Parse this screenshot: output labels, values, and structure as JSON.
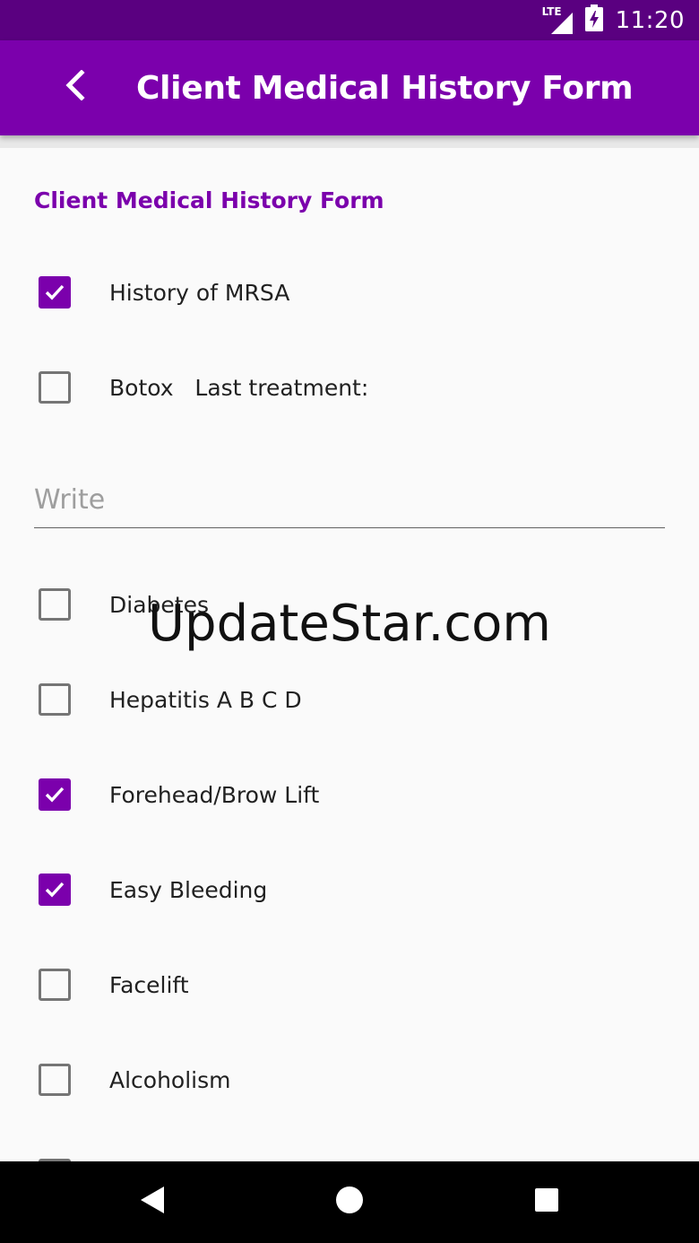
{
  "status_bar": {
    "network": "LTE",
    "time": "11:20",
    "icons": [
      "lte-signal-icon",
      "battery-charging-icon"
    ]
  },
  "app_bar": {
    "title": "Client Medical History Form",
    "back_icon": "chevron-left-icon"
  },
  "form": {
    "section_title": "Client Medical History Form",
    "items": [
      {
        "label": "History of MRSA",
        "checked": true
      },
      {
        "label": "Botox   Last treatment:",
        "checked": false
      },
      {
        "label": "Diabetes",
        "checked": false
      },
      {
        "label": "Hepatitis A B C D",
        "checked": false
      },
      {
        "label": "Forehead/Brow Lift",
        "checked": true
      },
      {
        "label": "Easy Bleeding",
        "checked": true
      },
      {
        "label": "Facelift",
        "checked": false
      },
      {
        "label": "Alcoholism",
        "checked": false
      }
    ],
    "write_field": {
      "placeholder": "Write",
      "value": ""
    }
  },
  "watermark": "UpdateStar.com",
  "nav_bar": {
    "icons": [
      "back-triangle-icon",
      "home-circle-icon",
      "recents-square-icon"
    ]
  },
  "colors": {
    "status_bar": "#5a0080",
    "app_bar": "#7b00ac",
    "accent": "#7b00ac",
    "nav_bar": "#000000"
  }
}
